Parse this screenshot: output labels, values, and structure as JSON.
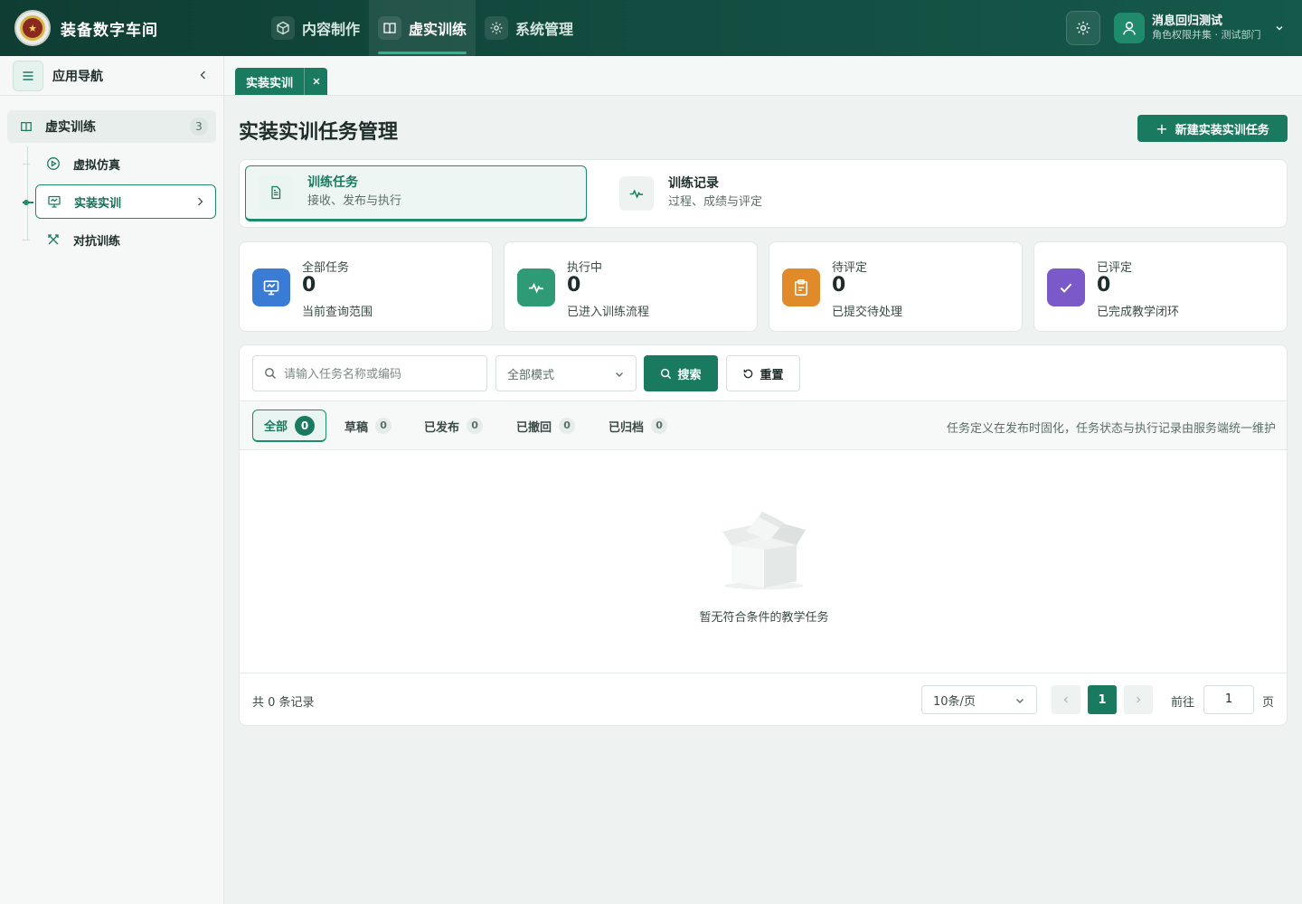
{
  "header": {
    "app_title": "装备数字车间",
    "nav": [
      {
        "label": "内容制作",
        "icon": "cube-icon"
      },
      {
        "label": "虚实训练",
        "icon": "book-icon",
        "active": true
      },
      {
        "label": "系统管理",
        "icon": "gear-icon"
      }
    ],
    "user": {
      "name": "消息回归测试",
      "role": "角色权限并集 · 测试部门"
    }
  },
  "sidebar": {
    "title": "应用导航",
    "group": {
      "label": "虚实训练",
      "count": "3"
    },
    "items": [
      {
        "label": "虚拟仿真",
        "icon": "play-circle-icon"
      },
      {
        "label": "实装实训",
        "icon": "monitor-icon",
        "active": true
      },
      {
        "label": "对抗训练",
        "icon": "swords-icon"
      }
    ]
  },
  "tabs": [
    {
      "label": "实装实训",
      "active": true
    }
  ],
  "page": {
    "title": "实装实训任务管理",
    "new_button": "新建实装实训任务",
    "modes": [
      {
        "label": "训练任务",
        "desc": "接收、发布与执行",
        "active": true
      },
      {
        "label": "训练记录",
        "desc": "过程、成绩与评定"
      }
    ],
    "stats": [
      {
        "label": "全部任务",
        "value": "0",
        "desc": "当前查询范围",
        "color": "#3a7bd5"
      },
      {
        "label": "执行中",
        "value": "0",
        "desc": "已进入训练流程",
        "color": "#2f9a76"
      },
      {
        "label": "待评定",
        "value": "0",
        "desc": "已提交待处理",
        "color": "#e08a2a"
      },
      {
        "label": "已评定",
        "value": "0",
        "desc": "已完成教学闭环",
        "color": "#7b59c9"
      }
    ],
    "search": {
      "placeholder": "请输入任务名称或编码",
      "mode_select": "全部模式",
      "search_button": "搜索",
      "reset_button": "重置"
    },
    "filters": [
      {
        "label": "全部",
        "count": "0",
        "active": true
      },
      {
        "label": "草稿",
        "count": "0"
      },
      {
        "label": "已发布",
        "count": "0"
      },
      {
        "label": "已撤回",
        "count": "0"
      },
      {
        "label": "已归档",
        "count": "0"
      }
    ],
    "filter_note": "任务定义在发布时固化，任务状态与执行记录由服务端统一维护",
    "empty_text": "暂无符合条件的教学任务",
    "pagination": {
      "total": "共 0 条记录",
      "page_size": "10条/页",
      "current": "1",
      "goto_label": "前往",
      "goto_value": "1",
      "suffix": "页"
    }
  },
  "colors": {
    "brand": "#1a7a60",
    "header_bg": "#0f3d33"
  }
}
